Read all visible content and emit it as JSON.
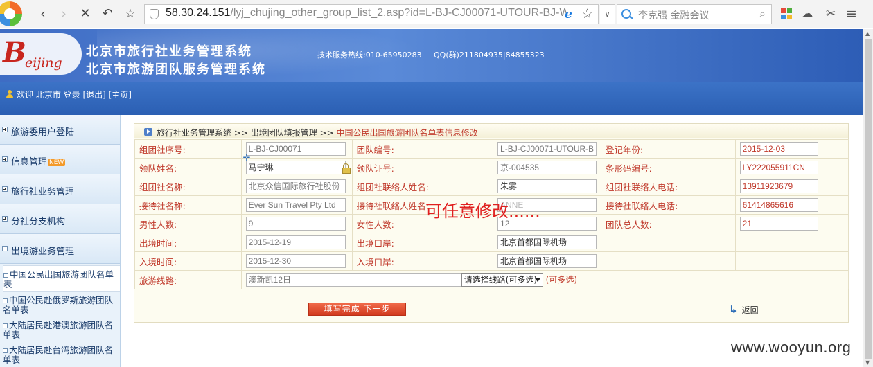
{
  "browser": {
    "url_host": "58.30.24.151",
    "url_rest": "/lyj_chujing_other_group_list_2.asp?id=L-BJ-CJ00071-UTOUR-BJ-W",
    "search_text": "李克强 金融会议",
    "icons": [
      "back-icon",
      "forward-icon",
      "stop-icon",
      "undo-icon",
      "star-icon",
      "shield-icon",
      "ie-icon",
      "search-icon",
      "apps-icon",
      "cloud-icon",
      "cut-icon",
      "menu-icon"
    ]
  },
  "header": {
    "title1": "北京市旅行社业务管理系统",
    "title2": "北京市旅游团队服务管理系统",
    "logo_letter": "B",
    "logo_word": "eijing",
    "hotline": "技术服务热线:010-65950283",
    "qq": "QQ(群)211804935|84855323"
  },
  "userbar": {
    "text": "欢迎 北京市 登录 [退出]  [主页]"
  },
  "nav": {
    "main": [
      {
        "label": "旅游委用户登陆",
        "expanded": false
      },
      {
        "label": "信息管理",
        "badge": "NEW",
        "expanded": false
      },
      {
        "label": "旅行社业务管理",
        "expanded": false
      },
      {
        "label": "分社分支机构",
        "expanded": false
      },
      {
        "label": "出境游业务管理",
        "expanded": true
      }
    ],
    "sub": [
      {
        "label": "中国公民出国旅游团队名单表",
        "active": true
      },
      {
        "label": "中国公民赴俄罗斯旅游团队名单表",
        "active": false
      },
      {
        "label": "大陆居民赴港澳旅游团队名单表",
        "active": false
      },
      {
        "label": "大陆居民赴台湾旅游团队名单表",
        "active": false
      }
    ]
  },
  "breadcrumb": {
    "part1": "旅行社业务管理系统",
    "part2": "出境团队填报管理",
    "current": "中国公民出国旅游团队名单表信息修改",
    "sep": " >> "
  },
  "form": {
    "zutuan_no_label": "组团社序号:",
    "zutuan_no": "L-BJ-CJ00071",
    "team_no_label": "团队编号:",
    "team_no": "L-BJ-CJ00071-UTOUR-B",
    "reg_year_label": "登记年份:",
    "reg_year": "2015-12-03",
    "leader_name_label": "领队姓名:",
    "leader_name": "马宁琳",
    "leader_cert_label": "领队证号:",
    "leader_cert": "京-004535",
    "barcode_label": "条形码编号:",
    "barcode": "LY222055911CN",
    "agency_name_label": "组团社名称:",
    "agency_name": "北京众信国际旅行社股份",
    "agency_contact_label": "组团社联络人姓名:",
    "agency_contact": "朱雾",
    "agency_phone_label": "组团社联络人电话:",
    "agency_phone": "13911923679",
    "recv_name_label": "接待社名称:",
    "recv_name": "Ever Sun Travel Pty Ltd",
    "recv_contact_label": "接待社联络人姓名:",
    "recv_contact": "ANNE",
    "recv_phone_label": "接待社联络人电话:",
    "recv_phone": "61414865616",
    "male_label": "男性人数:",
    "male": "9",
    "female_label": "女性人数:",
    "female": "12",
    "total_label": "团队总人数:",
    "total": "21",
    "depart_time_label": "出境时间:",
    "depart_time": "2015-12-19",
    "depart_port_label": "出境口岸:",
    "depart_port": "北京首都国际机场",
    "enter_time_label": "入境时间:",
    "enter_time": "2015-12-30",
    "enter_port_label": "入境口岸:",
    "enter_port": "北京首都国际机场",
    "route_label": "旅游线路:",
    "route": "澳新凯12日",
    "route_select": "请选择线路(可多选)",
    "route_hint": "(可多选)"
  },
  "buttons": {
    "next": "填写完成  下一步",
    "back": "返回"
  },
  "overlay_text": "可任意修改......",
  "watermark": "www.wooyun.org"
}
